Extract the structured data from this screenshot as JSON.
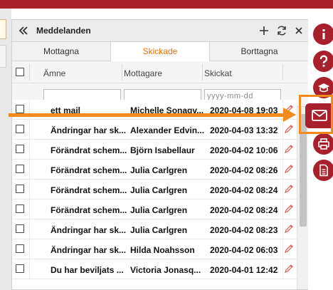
{
  "panel": {
    "title": "Meddelanden",
    "icons": [
      "double-chevron-left-icon",
      "plus-icon",
      "refresh-icon",
      "close-icon"
    ]
  },
  "tabs": [
    {
      "label": "Mottagna",
      "active": false
    },
    {
      "label": "Skickade",
      "active": true
    },
    {
      "label": "Borttagna",
      "active": false
    }
  ],
  "columns": {
    "subject": "Ämne",
    "recipient": "Mottagare",
    "sent": "Skickat"
  },
  "filters": {
    "subject_value": "",
    "recipient_value": "",
    "date_placeholder": "yyyy-mm-dd"
  },
  "rows": [
    {
      "subject": "ett mail",
      "recipient": "Michelle Sonaqv...",
      "sent": "2020-04-08 19:03"
    },
    {
      "subject": "Ändringar har sk...",
      "recipient": "Alexander Edvin...",
      "sent": "2020-04-03 13:32"
    },
    {
      "subject": "Förändrat schem...",
      "recipient": "Björn Isabellaur",
      "sent": "2020-04-02 10:06"
    },
    {
      "subject": "Förändrat schem...",
      "recipient": "Julia Carlgren",
      "sent": "2020-04-02 08:26"
    },
    {
      "subject": "Förändrat schem...",
      "recipient": "Julia Carlgren",
      "sent": "2020-04-02 08:24"
    },
    {
      "subject": "Förändrat schem...",
      "recipient": "Julia Carlgren",
      "sent": "2020-04-02 08:24"
    },
    {
      "subject": "Ändringar har sk...",
      "recipient": "Julia Carlgren",
      "sent": "2020-04-02 08:23"
    },
    {
      "subject": "Ändringar har sk...",
      "recipient": "Hilda Noahsson",
      "sent": "2020-04-02 06:03"
    },
    {
      "subject": "Du har beviljats ...",
      "recipient": "Victoria Jonasq...",
      "sent": "2020-04-01 12:42"
    }
  ],
  "right_rail": [
    "info-icon",
    "help-icon",
    "education-icon",
    "mail-icon",
    "print-icon",
    "document-icon"
  ],
  "colors": {
    "brand": "#a8202b",
    "accent": "#e9730b",
    "annotation": "#f28a1d"
  }
}
